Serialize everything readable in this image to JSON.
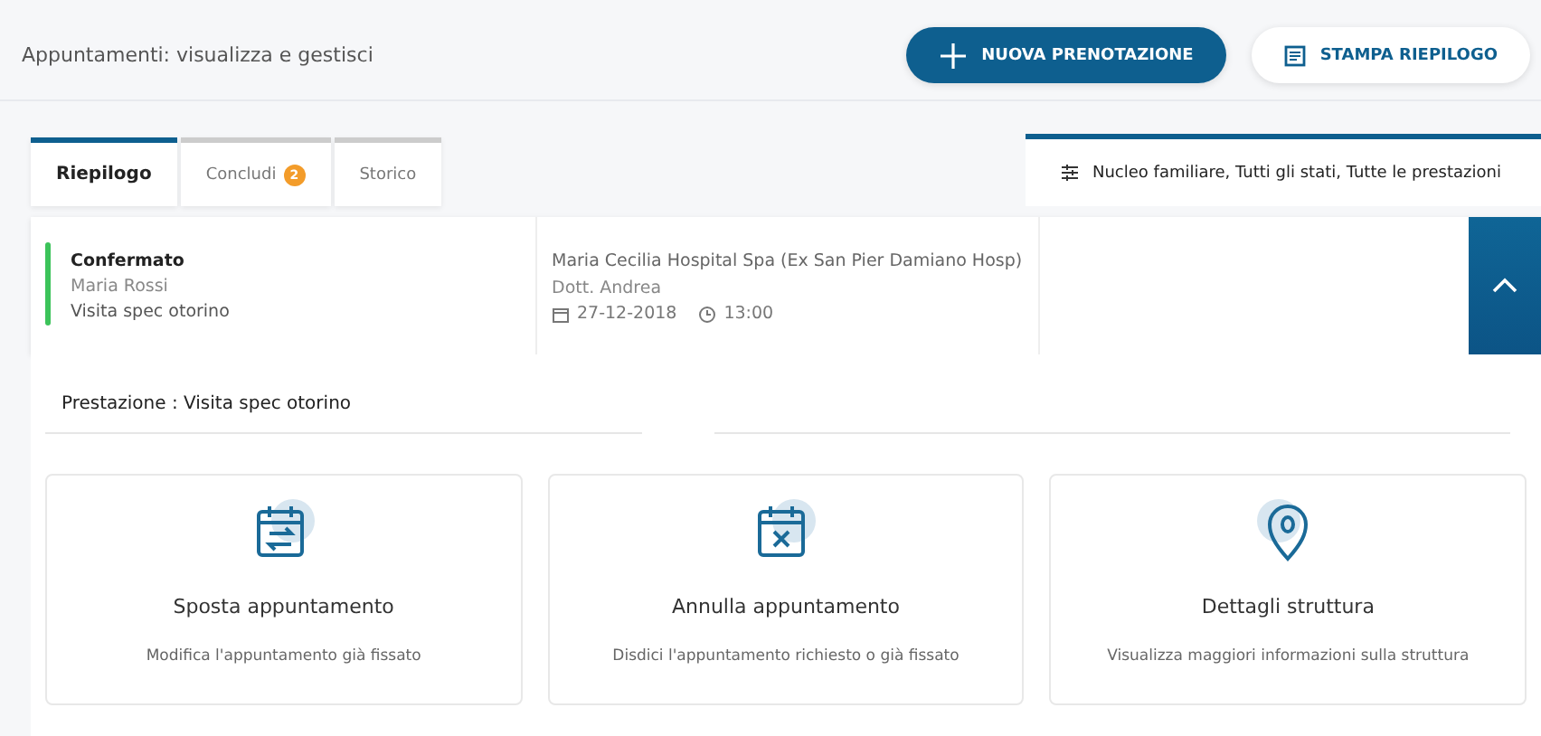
{
  "header": {
    "title": "Appuntamenti: visualizza e gestisci",
    "buttons": [
      {
        "label": "NUOVA PRENOTAZIONE",
        "kind": "primary"
      },
      {
        "label": "STAMPA RIEPILOGO",
        "kind": "secondary"
      }
    ]
  },
  "tabs": [
    {
      "label": "Riepilogo",
      "selected": true
    },
    {
      "label": "Concludi",
      "selected": false,
      "badge": "2"
    },
    {
      "label": "Storico",
      "selected": false
    }
  ],
  "filter": {
    "label": "Nucleo familiare, Tutti gli stati, Tutte le prestazioni"
  },
  "appointment": {
    "status": "Confermato",
    "color": "#3cc35a",
    "patient": "Maria Rossi",
    "service": "Visita spec otorino",
    "facility": "Maria Cecilia Hospital Spa (Ex San Pier Damiano Hosp)",
    "doctor": "Dott. Andrea",
    "date": "27-12-2018",
    "time": "13:00",
    "expanded": true
  },
  "detail": {
    "heading": "Prestazione : Visita spec otorino",
    "actions": [
      {
        "kind": "reschedule",
        "title": "Sposta appuntamento",
        "description": "Modifica l'appuntamento già fissato"
      },
      {
        "kind": "cancel",
        "title": "Annulla appuntamento",
        "description": "Disdici l'appuntamento richiesto o già fissato"
      },
      {
        "kind": "location",
        "title": "Dettagli struttura",
        "description": "Visualizza maggiori informazioni sulla struttura"
      }
    ]
  }
}
